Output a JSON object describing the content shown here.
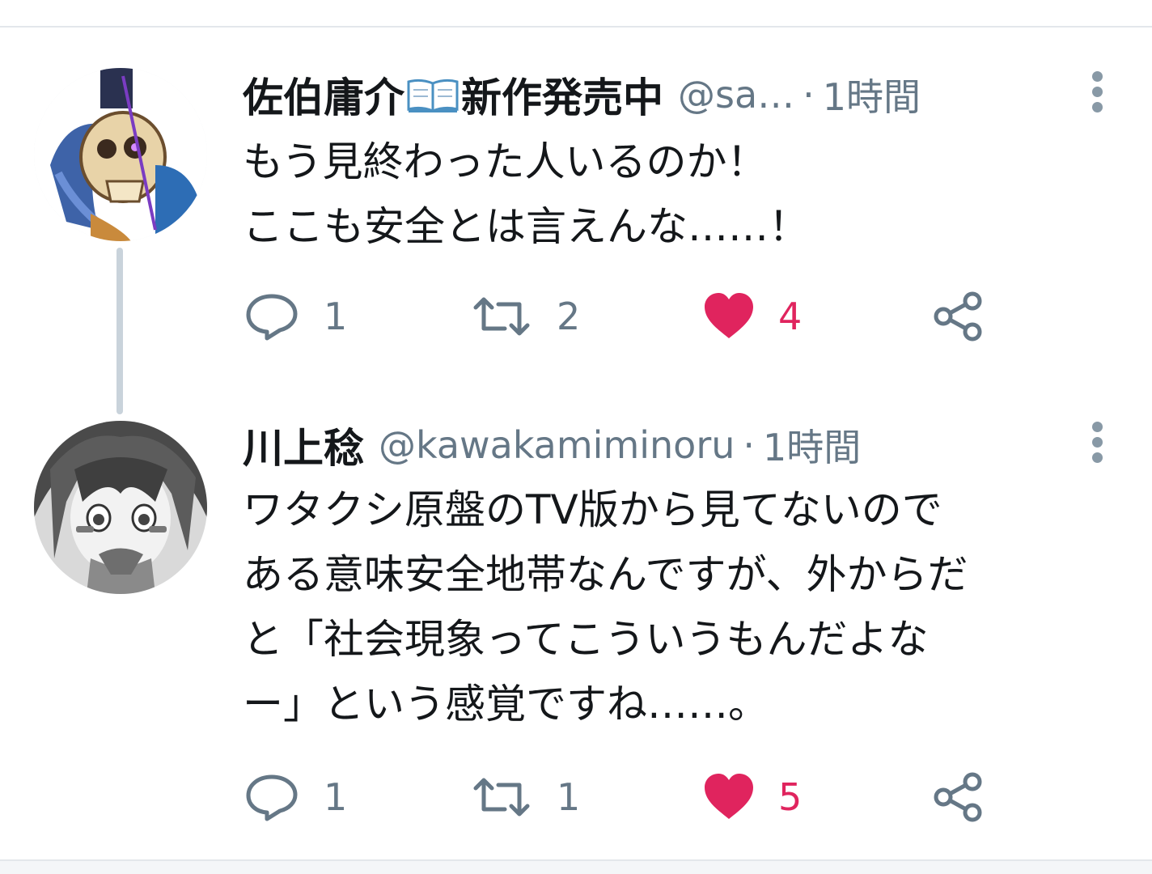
{
  "tweets": [
    {
      "display_name": "佐伯庸介",
      "name_suffix": "新作発売中",
      "name_emoji": "open-book-emoji",
      "handle": "@sa…",
      "separator": "·",
      "time": "1時間",
      "text": "もう見終わった人いるのか！\nここも安全とは言えんな……！",
      "reply_count": "1",
      "retweet_count": "2",
      "like_count": "4",
      "liked": true,
      "avatar": "skull-character-avatar"
    },
    {
      "display_name": "川上稔",
      "handle": "@kawakamiminoru",
      "separator": "·",
      "time": "1時間",
      "text": "ワタクシ原盤のTV版から見てないので\nある意味安全地帯なんですが、外からだ\nと「社会現象ってこういうもんだよな\nー」という感覚ですね……。",
      "reply_count": "1",
      "retweet_count": "1",
      "like_count": "5",
      "liked": true,
      "avatar": "anime-girl-avatar"
    }
  ],
  "colors": {
    "like": "#e0245e",
    "muted": "#657786",
    "text": "#14171a",
    "divider": "#e3e7eb"
  },
  "icons": [
    "reply-icon",
    "retweet-icon",
    "heart-icon",
    "share-icon",
    "more-options-icon"
  ]
}
